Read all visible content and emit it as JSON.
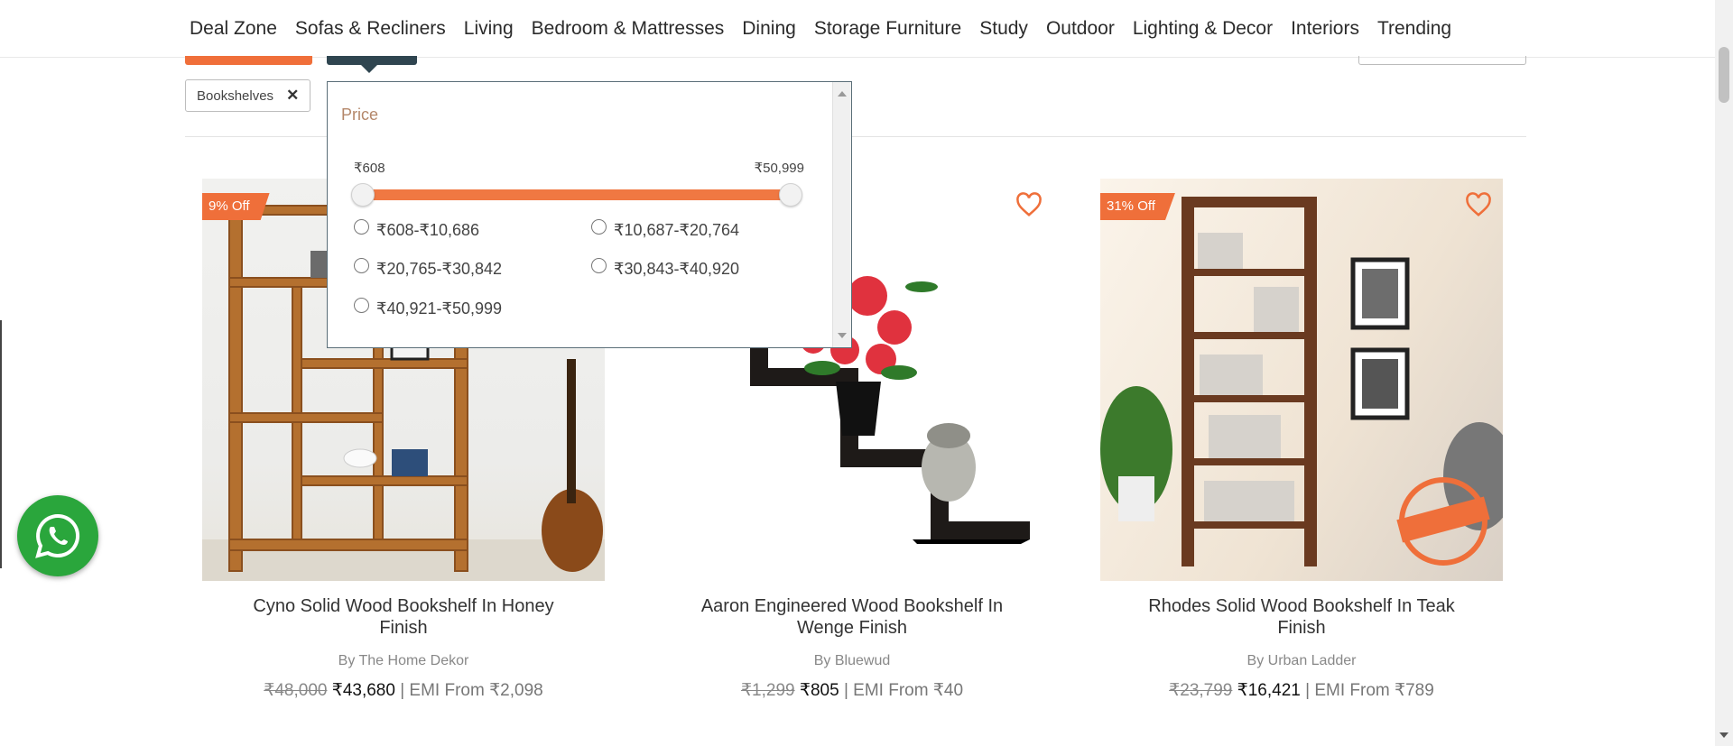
{
  "nav": {
    "items": [
      "Deal Zone",
      "Sofas & Recliners",
      "Living",
      "Bedroom & Mattresses",
      "Dining",
      "Storage Furniture",
      "Study",
      "Outdoor",
      "Lighting & Decor",
      "Interiors",
      "Trending"
    ]
  },
  "filters": {
    "chip_label": "Bookshelves",
    "chip_remove": "✕"
  },
  "price_popover": {
    "title": "Price",
    "min_label": "₹608",
    "max_label": "₹50,999",
    "slider_min_fraction": 0,
    "slider_max_fraction": 1,
    "options": [
      "₹608-₹10,686",
      "₹10,687-₹20,764",
      "₹20,765-₹30,842",
      "₹30,843-₹40,920",
      "₹40,921-₹50,999"
    ]
  },
  "products": [
    {
      "discount": "9% Off",
      "name": "Cyno Solid Wood Bookshelf In Honey Finish",
      "brand": "By The Home Dekor",
      "mrp": "₹48,000",
      "price": "₹43,680",
      "emi": "| EMI From ₹2,098"
    },
    {
      "discount": "",
      "name": "Aaron Engineered Wood Bookshelf In Wenge Finish",
      "brand": "By Bluewud",
      "mrp": "₹1,299",
      "price": "₹805",
      "emi": "| EMI From ₹40"
    },
    {
      "discount": "31% Off",
      "name": "Rhodes Solid Wood Bookshelf In Teak Finish",
      "brand": "By Urban Ladder",
      "mrp": "₹23,799",
      "price": "₹16,421",
      "emi": "| EMI From ₹789"
    }
  ],
  "colors": {
    "accent": "#f06f3a",
    "dark": "#2f4550",
    "whatsapp": "#2aa63c"
  }
}
